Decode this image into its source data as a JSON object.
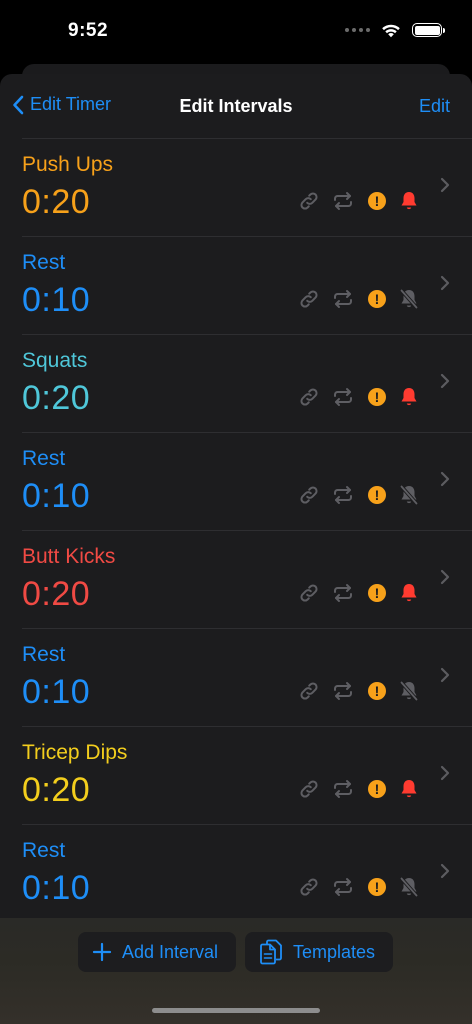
{
  "status_bar": {
    "time": "9:52"
  },
  "nav": {
    "back_label": "Edit Timer",
    "title": "Edit Intervals",
    "edit_label": "Edit"
  },
  "intervals": [
    {
      "name": "Push Ups",
      "duration": "0:20",
      "color": "#f7a11a",
      "bell": "on"
    },
    {
      "name": "Rest",
      "duration": "0:10",
      "color": "#1e8ef7",
      "bell": "off"
    },
    {
      "name": "Squats",
      "duration": "0:20",
      "color": "#4fc7d9",
      "bell": "on"
    },
    {
      "name": "Rest",
      "duration": "0:10",
      "color": "#1e8ef7",
      "bell": "off"
    },
    {
      "name": "Butt Kicks",
      "duration": "0:20",
      "color": "#f04a44",
      "bell": "on"
    },
    {
      "name": "Rest",
      "duration": "0:10",
      "color": "#1e8ef7",
      "bell": "off"
    },
    {
      "name": "Tricep Dips",
      "duration": "0:20",
      "color": "#f3ce1d",
      "bell": "on"
    },
    {
      "name": "Rest",
      "duration": "0:10",
      "color": "#1e8ef7",
      "bell": "off"
    }
  ],
  "row_icons": {
    "link": "link-icon",
    "repeat": "repeat-icon",
    "alert": "exclamation-circle-icon",
    "alert_glyph": "!",
    "bell_on": "bell-icon",
    "bell_off": "bell-slash-icon",
    "chevron": "chevron-right-icon"
  },
  "toolbar": {
    "add_label": "Add Interval",
    "templates_label": "Templates"
  },
  "colors": {
    "accent": "#1e8ef7",
    "alert": "#f7a11a",
    "bell_on": "#ff3b30",
    "icon_muted": "#5e5e63"
  }
}
